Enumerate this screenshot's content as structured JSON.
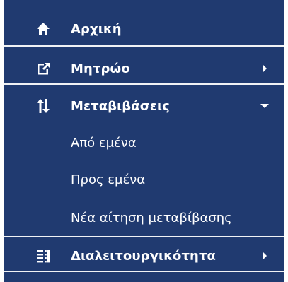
{
  "menu": {
    "items": [
      {
        "label": "Αρχική",
        "icon": "home-icon"
      },
      {
        "label": "Μητρώο",
        "icon": "external-link-icon",
        "arrow": "chevron-right-icon"
      },
      {
        "label": "Μεταβιβάσεις",
        "icon": "transfer-arrows-icon",
        "arrow": "caret-down-icon"
      },
      {
        "label": "Διαλειτουργικότητα",
        "icon": "list-icon",
        "arrow": "chevron-right-icon"
      }
    ],
    "subitems": [
      {
        "label": "Από εμένα"
      },
      {
        "label": "Προς εμένα"
      },
      {
        "label": "Νέα αίτηση μεταβίβασης"
      }
    ]
  },
  "colors": {
    "background": "#203a70",
    "divider": "#f0f2f5",
    "text": "#ffffff"
  }
}
